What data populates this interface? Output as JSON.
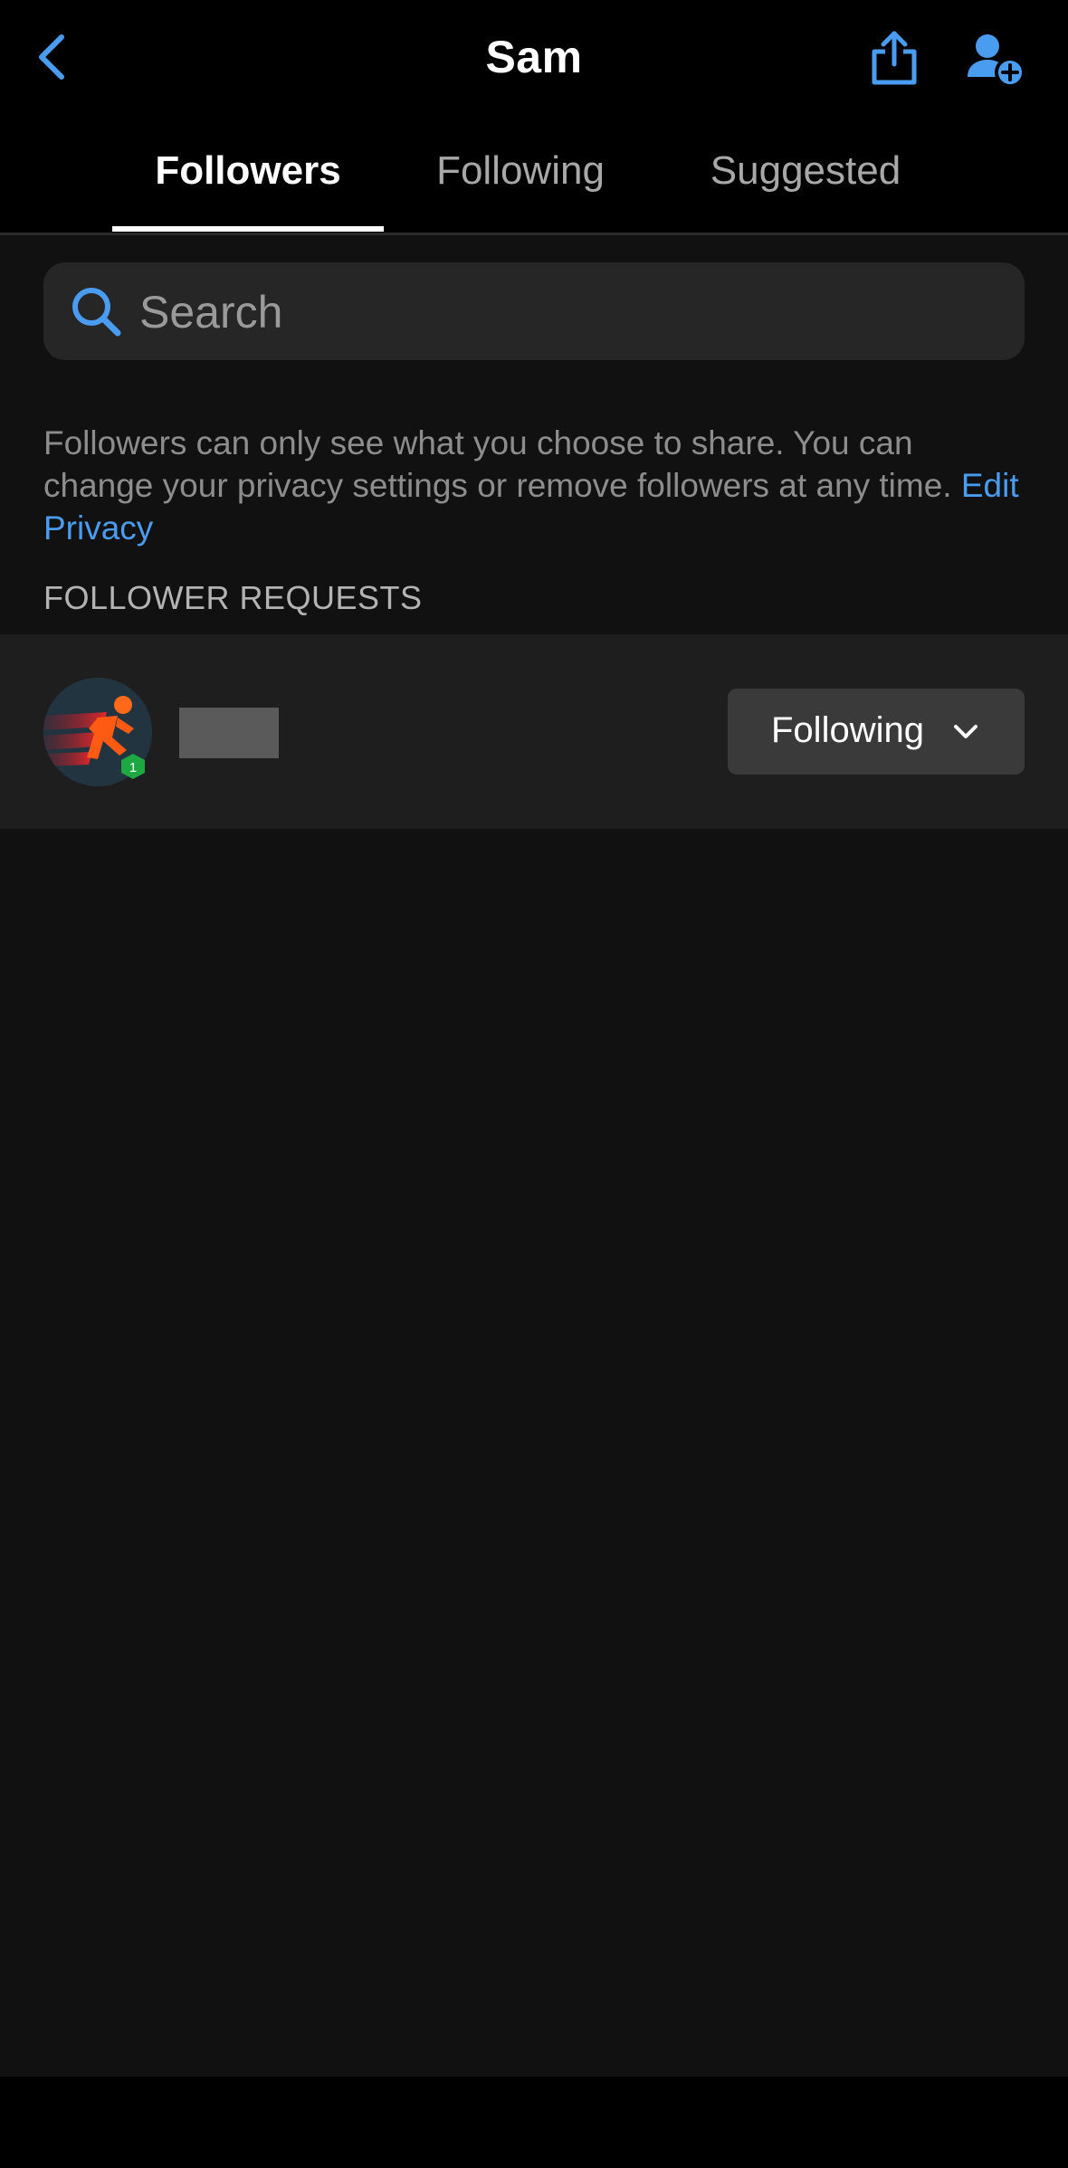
{
  "header": {
    "title": "Sam",
    "back_icon": "chevron-left-icon",
    "share_icon": "share-icon",
    "add_user_icon": "add-user-icon",
    "accent_color": "#4a9cf0"
  },
  "tabs": [
    {
      "label": "Followers",
      "active": true
    },
    {
      "label": "Following",
      "active": false
    },
    {
      "label": "Suggested",
      "active": false
    }
  ],
  "search": {
    "placeholder": "Search",
    "icon": "search-icon"
  },
  "info": {
    "text": "Followers can only see what you choose to share. You can change your privacy settings or remove followers at any time.",
    "link_label": "Edit Privacy"
  },
  "follower_requests": {
    "header": "FOLLOWER REQUESTS",
    "items": [
      {
        "avatar_icon": "runner-icon",
        "level_badge": "1",
        "button_label": "Following",
        "button_icon": "chevron-down-icon"
      }
    ]
  }
}
